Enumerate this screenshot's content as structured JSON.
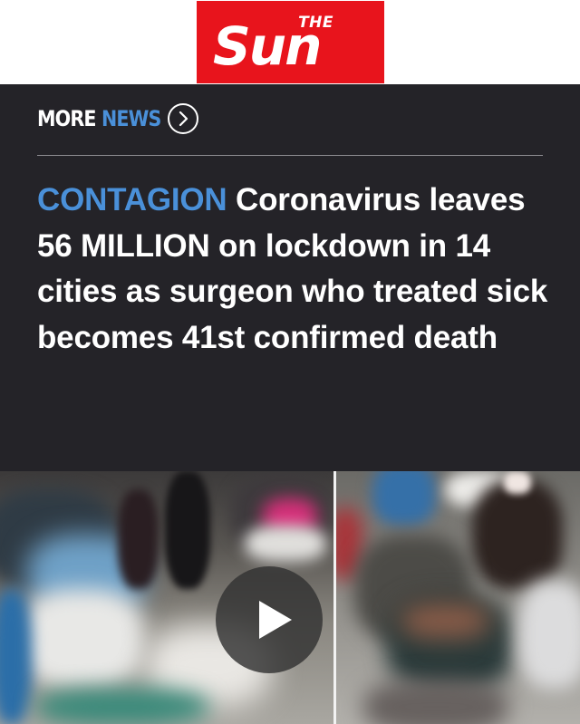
{
  "masthead": {
    "logo_top": "THE",
    "logo_main": "Sun",
    "logo_color": "#e8141c"
  },
  "more_news": {
    "word1": "MORE",
    "word2": "NEWS",
    "arrow_icon": "chevron-right-circle-icon",
    "accent": "#4a90d9"
  },
  "article": {
    "kicker": "CONTAGION",
    "headline": "Coronavirus leaves 56 MILLION on lockdown in 14 cities as surgeon who treated sick becomes 41st confirmed death"
  },
  "media": {
    "play_icon": "play-icon",
    "background": "#242328"
  }
}
